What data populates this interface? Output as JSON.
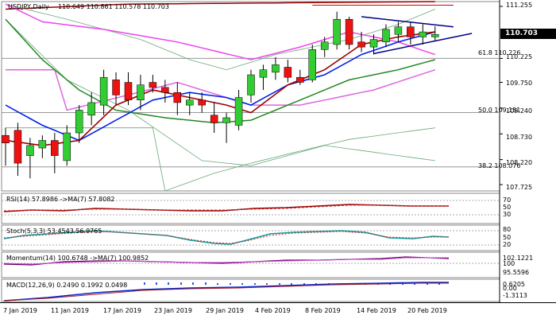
{
  "header": {
    "symbol": "USDJPY,Daily",
    "ohlc": "110.649 110.861 110.578 110.703"
  },
  "colors": {
    "bull": "#33cc33",
    "bear": "#ee1111",
    "ma_blue": "#0022ee",
    "ma_darkred": "#990000",
    "ma_green": "#228822",
    "ma_magenta": "#ee44ee",
    "ma_pink": "#dd66dd",
    "band_green": "#66aa77",
    "trend_navy": "#000088",
    "trend_red": "#cc0000",
    "price_tag_bg": "#000000",
    "price_tag_fg": "#ffffff"
  },
  "main": {
    "price_tag": "110.703",
    "price_axis_labels": [
      "111.255",
      "110.225",
      "109.750",
      "109.240",
      "108.730",
      "108.220",
      "107.725"
    ],
    "fib_levels": [
      {
        "label": "61.8 110.226"
      },
      {
        "label": "50.0 109.151"
      },
      {
        "label": "38.2 108.076"
      }
    ]
  },
  "rsi": {
    "label": "RSI(14) 57.8986  ->MA(7) 57.8082",
    "axis_labels": [
      "70",
      "50",
      "30"
    ]
  },
  "stoch": {
    "label": "Stoch(5,3,3) 53.4543 56.9765",
    "axis_labels": [
      "80",
      "50",
      "20"
    ]
  },
  "momentum": {
    "label": "Momentum(14) 100.6748  ->MA(7) 100.9852",
    "axis_labels": [
      "102.1221",
      "100",
      "95.5596"
    ]
  },
  "macd": {
    "label": "MACD(12,26,9) 0.2490 0.1992 0.0498",
    "axis_labels": [
      "0.6205",
      "0.00",
      "-1.3113"
    ]
  },
  "dates": [
    "7 Jan 2019",
    "11 Jan 2019",
    "17 Jan 2019",
    "23 Jan 2019",
    "29 Jan 2019",
    "4 Feb 2019",
    "8 Feb 2019",
    "14 Feb 2019",
    "20 Feb 2019"
  ],
  "chart_data": {
    "type": "candlestick",
    "title": "USDJPY,Daily",
    "ylim": [
      107.6,
      111.35
    ],
    "candles": [
      {
        "o": 108.7,
        "h": 108.85,
        "l": 108.1,
        "c": 108.55
      },
      {
        "o": 108.8,
        "h": 108.95,
        "l": 107.9,
        "c": 108.15
      },
      {
        "o": 108.3,
        "h": 108.65,
        "l": 107.85,
        "c": 108.5
      },
      {
        "o": 108.45,
        "h": 108.7,
        "l": 108.25,
        "c": 108.6
      },
      {
        "o": 108.6,
        "h": 108.75,
        "l": 107.95,
        "c": 108.3
      },
      {
        "o": 108.2,
        "h": 108.9,
        "l": 108.1,
        "c": 108.75
      },
      {
        "o": 108.75,
        "h": 109.3,
        "l": 108.55,
        "c": 109.2
      },
      {
        "o": 109.1,
        "h": 109.55,
        "l": 108.9,
        "c": 109.35
      },
      {
        "o": 109.3,
        "h": 110.0,
        "l": 109.1,
        "c": 109.85
      },
      {
        "o": 109.8,
        "h": 109.95,
        "l": 109.3,
        "c": 109.5
      },
      {
        "o": 109.75,
        "h": 109.95,
        "l": 109.3,
        "c": 109.4
      },
      {
        "o": 109.4,
        "h": 109.9,
        "l": 109.2,
        "c": 109.7
      },
      {
        "o": 109.75,
        "h": 109.9,
        "l": 109.55,
        "c": 109.65
      },
      {
        "o": 109.65,
        "h": 109.8,
        "l": 109.35,
        "c": 109.55
      },
      {
        "o": 109.55,
        "h": 109.75,
        "l": 109.1,
        "c": 109.35
      },
      {
        "o": 109.3,
        "h": 109.55,
        "l": 109.1,
        "c": 109.4
      },
      {
        "o": 109.4,
        "h": 109.55,
        "l": 109.15,
        "c": 109.3
      },
      {
        "o": 109.1,
        "h": 109.35,
        "l": 108.75,
        "c": 108.95
      },
      {
        "o": 108.95,
        "h": 109.15,
        "l": 108.55,
        "c": 109.05
      },
      {
        "o": 108.9,
        "h": 109.6,
        "l": 108.8,
        "c": 109.45
      },
      {
        "o": 109.5,
        "h": 110.0,
        "l": 109.35,
        "c": 109.9
      },
      {
        "o": 109.85,
        "h": 110.1,
        "l": 109.6,
        "c": 110.0
      },
      {
        "o": 109.95,
        "h": 110.25,
        "l": 109.8,
        "c": 110.1
      },
      {
        "o": 110.05,
        "h": 110.2,
        "l": 109.75,
        "c": 109.85
      },
      {
        "o": 109.85,
        "h": 110.0,
        "l": 109.7,
        "c": 109.75
      },
      {
        "o": 109.8,
        "h": 110.5,
        "l": 109.75,
        "c": 110.4
      },
      {
        "o": 110.4,
        "h": 110.65,
        "l": 110.25,
        "c": 110.55
      },
      {
        "o": 110.5,
        "h": 111.15,
        "l": 110.4,
        "c": 111.0
      },
      {
        "o": 111.0,
        "h": 111.05,
        "l": 110.4,
        "c": 110.5
      },
      {
        "o": 110.55,
        "h": 110.75,
        "l": 110.35,
        "c": 110.45
      },
      {
        "o": 110.45,
        "h": 110.7,
        "l": 110.3,
        "c": 110.6
      },
      {
        "o": 110.55,
        "h": 110.9,
        "l": 110.45,
        "c": 110.8
      },
      {
        "o": 110.7,
        "h": 110.95,
        "l": 110.55,
        "c": 110.85
      },
      {
        "o": 110.85,
        "h": 110.95,
        "l": 110.5,
        "c": 110.65
      },
      {
        "o": 110.65,
        "h": 110.9,
        "l": 110.5,
        "c": 110.75
      },
      {
        "o": 110.65,
        "h": 110.86,
        "l": 110.58,
        "c": 110.7
      }
    ]
  }
}
